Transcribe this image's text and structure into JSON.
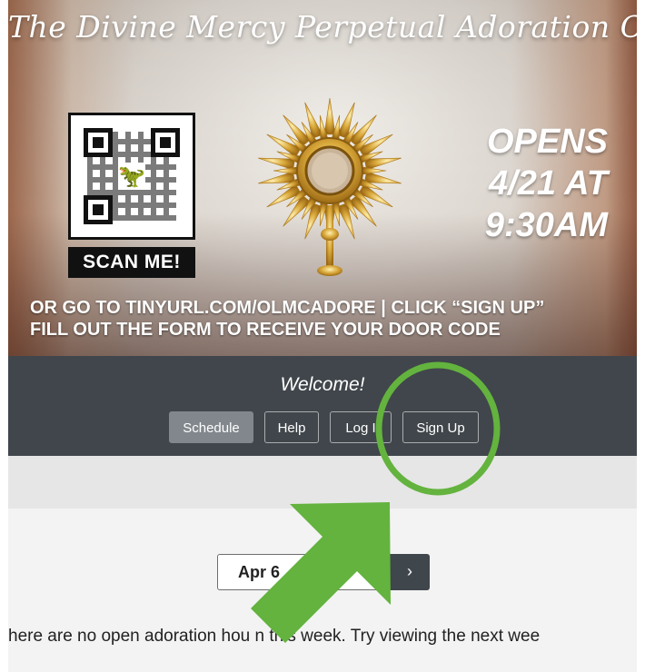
{
  "banner": {
    "title": "The Divine Mercy Perpetual Adoration Chapel",
    "qr_caption": "SCAN ME!",
    "opens_line1": "OPENS",
    "opens_line2": "4/21 AT",
    "opens_line3": "9:30AM",
    "instruction_line1": "OR GO TO TINYURL.COM/OLMCADORE | CLICK “SIGN UP”",
    "instruction_line2": "FILL OUT THE FORM TO RECEIVE YOUR DOOR CODE"
  },
  "nav": {
    "welcome": "Welcome!",
    "buttons": {
      "schedule": "Schedule",
      "help": "Help",
      "login": "Log I",
      "signup": "Sign Up"
    }
  },
  "schedule": {
    "week_label": "Apr 6",
    "next_icon": "chevron-right-icon",
    "empty_message": "here are no open adoration hou     n this week. Try viewing the next wee"
  },
  "annotations": {
    "highlight_color": "#63b33e",
    "circle_target": "Sign Up",
    "arrow_icon": "arrow-up-right-icon"
  }
}
